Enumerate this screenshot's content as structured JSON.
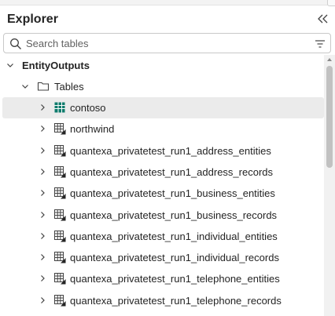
{
  "explorer": {
    "title": "Explorer",
    "collapse_icon": "double-chevron-left-icon"
  },
  "search": {
    "placeholder": "Search tables",
    "value": "",
    "icon": "search-icon",
    "filter_icon": "filter-icon"
  },
  "tree": {
    "database": {
      "label": "EntityOutputs",
      "expanded": true
    },
    "folder": {
      "label": "Tables",
      "expanded": true,
      "icon": "folder-icon"
    },
    "tables": [
      {
        "label": "contoso",
        "selected": true,
        "icon": "table-icon-green"
      },
      {
        "label": "northwind",
        "selected": false,
        "icon": "shortcut-table-icon"
      },
      {
        "label": "quantexa_privatetest_run1_address_entities",
        "selected": false,
        "icon": "shortcut-table-icon"
      },
      {
        "label": "quantexa_privatetest_run1_address_records",
        "selected": false,
        "icon": "shortcut-table-icon"
      },
      {
        "label": "quantexa_privatetest_run1_business_entities",
        "selected": false,
        "icon": "shortcut-table-icon"
      },
      {
        "label": "quantexa_privatetest_run1_business_records",
        "selected": false,
        "icon": "shortcut-table-icon"
      },
      {
        "label": "quantexa_privatetest_run1_individual_entities",
        "selected": false,
        "icon": "shortcut-table-icon"
      },
      {
        "label": "quantexa_privatetest_run1_individual_records",
        "selected": false,
        "icon": "shortcut-table-icon"
      },
      {
        "label": "quantexa_privatetest_run1_telephone_entities",
        "selected": false,
        "icon": "shortcut-table-icon"
      },
      {
        "label": "quantexa_privatetest_run1_telephone_records",
        "selected": false,
        "icon": "shortcut-table-icon"
      }
    ]
  },
  "colors": {
    "selected_row": "#ebebeb",
    "table_green": "#0f7b6c",
    "text": "#242424"
  }
}
